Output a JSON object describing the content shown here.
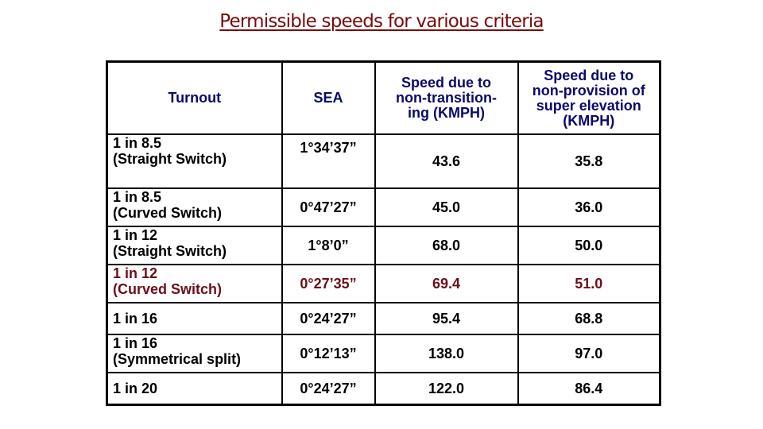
{
  "title": "Permissible speeds for various criteria",
  "colors": {
    "title": "#7a0a0a",
    "header_text": "#0a0a6a",
    "highlight_row": "#6b0f1a",
    "body_text": "#000000",
    "border": "#000000"
  },
  "table": {
    "headers": [
      {
        "lines": [
          "Turnout"
        ]
      },
      {
        "lines": [
          "SEA"
        ]
      },
      {
        "lines": [
          "Speed due to",
          "non-transition-",
          "ing (KMPH)"
        ]
      },
      {
        "lines": [
          "Speed due to",
          "non-provision of",
          "super elevation",
          "(KMPH)"
        ]
      }
    ],
    "rows": [
      {
        "turnout": [
          "1 in 8.5",
          "(Straight Switch)"
        ],
        "sea": "1°34’37”",
        "non_transitioning": "43.6",
        "non_super_elevation": "35.8",
        "highlight": false
      },
      {
        "turnout": [
          "1 in 8.5",
          "(Curved Switch)"
        ],
        "sea": "0°47’27”",
        "non_transitioning": "45.0",
        "non_super_elevation": "36.0",
        "highlight": false
      },
      {
        "turnout": [
          "1 in 12",
          "(Straight Switch)"
        ],
        "sea": "1°8’0”",
        "non_transitioning": "68.0",
        "non_super_elevation": "50.0",
        "highlight": false
      },
      {
        "turnout": [
          "1 in 12",
          "(Curved Switch)"
        ],
        "sea": "0°27’35”",
        "non_transitioning": "69.4",
        "non_super_elevation": "51.0",
        "highlight": true
      },
      {
        "turnout": [
          "1 in 16"
        ],
        "sea": "0°24’27”",
        "non_transitioning": "95.4",
        "non_super_elevation": "68.8",
        "highlight": false
      },
      {
        "turnout": [
          "1 in 16",
          "(Symmetrical split)"
        ],
        "sea": "0°12’13”",
        "non_transitioning": "138.0",
        "non_super_elevation": "97.0",
        "highlight": false
      },
      {
        "turnout": [
          "1 in 20"
        ],
        "sea": "0°24’27”",
        "non_transitioning": "122.0",
        "non_super_elevation": "86.4",
        "highlight": false
      }
    ]
  }
}
